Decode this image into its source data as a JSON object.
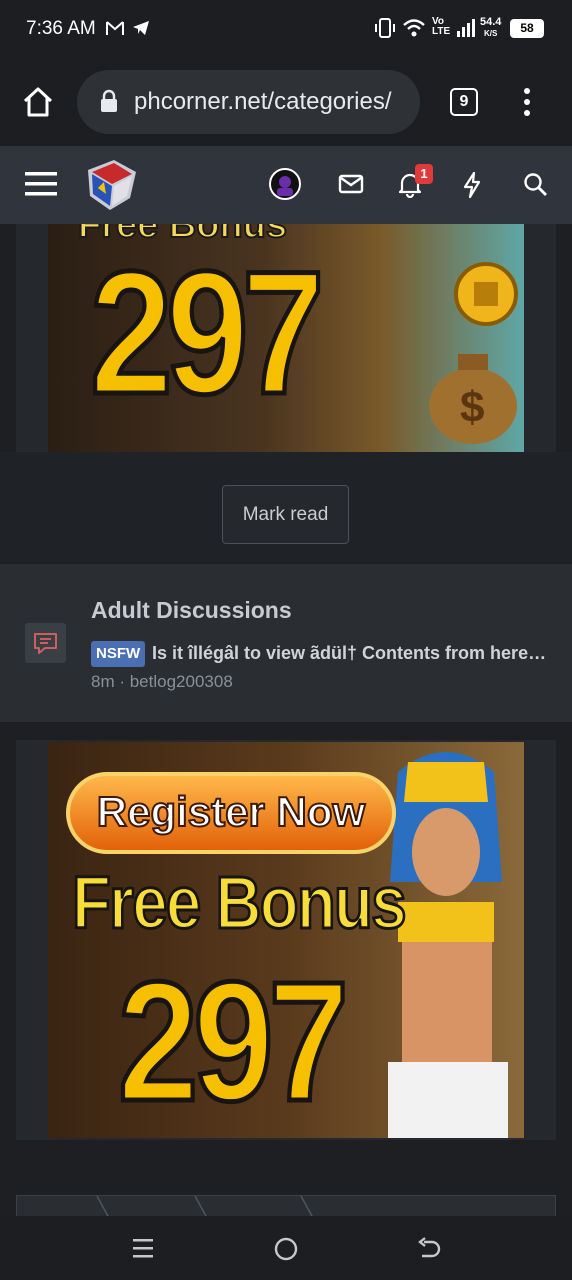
{
  "status": {
    "time": "7:36 AM",
    "speed": "54.4",
    "speed_unit": "K/S",
    "battery": "58",
    "volte": "Vo LTE"
  },
  "browser": {
    "url": "phcorner.net/categories/",
    "tab_count": "9"
  },
  "header": {
    "notification_count": "1"
  },
  "banner_top": {
    "partial_title": "Free Bonus",
    "amount": "297"
  },
  "mark_read_label": "Mark read",
  "forum": {
    "title": "Adult Discussions",
    "badge": "NSFW",
    "thread_title": "Is it îllégâl to view ãdül† Contents from here ...",
    "meta": "8m · betlog200308"
  },
  "banner_bottom": {
    "cta": "Register Now",
    "title": "Free Bonus",
    "amount": "297"
  },
  "colors": {
    "accent": "#4a6fb3",
    "badge_red": "#e03a3a",
    "gold": "#f7c500"
  }
}
